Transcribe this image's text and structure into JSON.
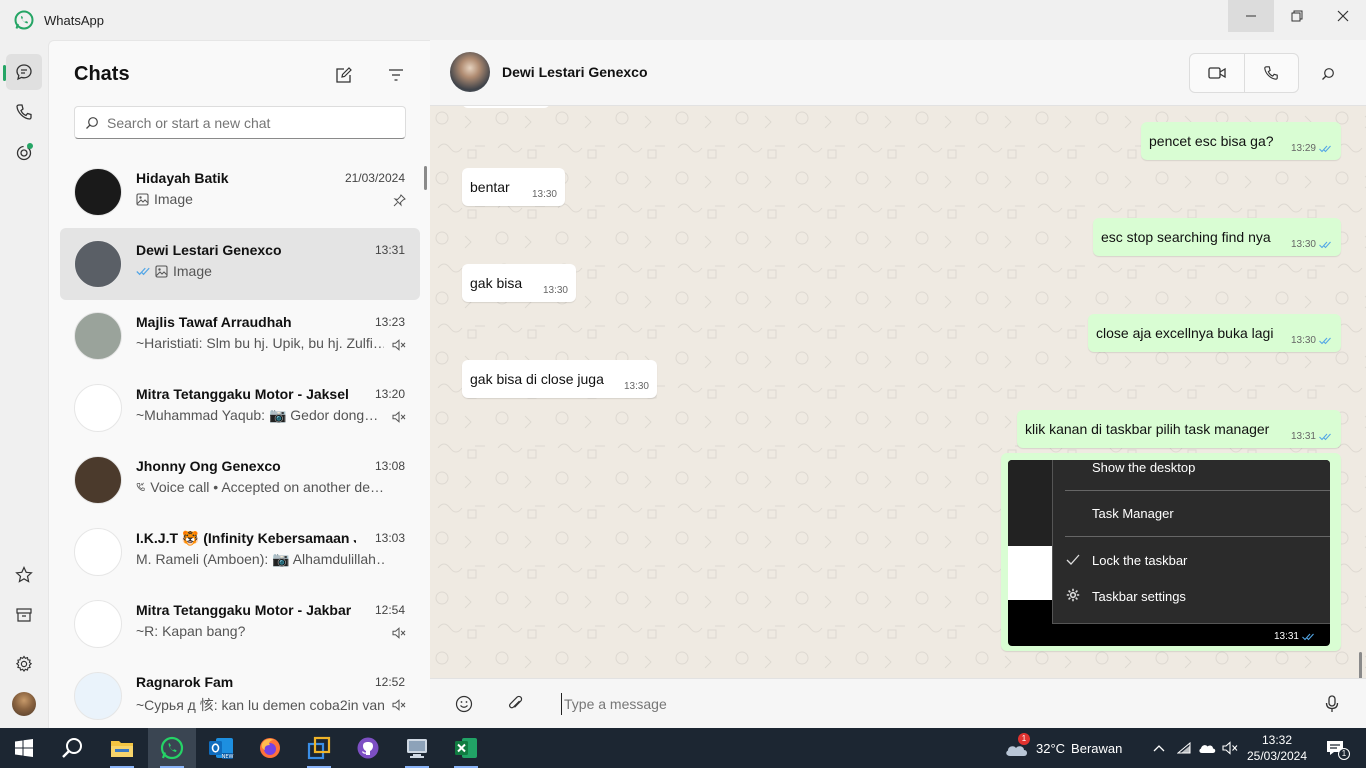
{
  "window": {
    "title": "WhatsApp"
  },
  "sidebar": {
    "title": "Chats",
    "search_placeholder": "Search or start a new chat",
    "chats": [
      {
        "name": "Hidayah Batik",
        "time": "21/03/2024",
        "preview": "Image",
        "preview_icon": "image-icon",
        "status_icon": "pin-icon",
        "avatar_color": "#1a1a1a"
      },
      {
        "name": "Dewi Lestari Genexco",
        "time": "13:31",
        "preview": "Image",
        "preview_icon": "image-icon",
        "ticks": true,
        "avatar_color": "#5a5f66",
        "selected": true
      },
      {
        "name": "Majlis Tawaf Arraudhah",
        "time": "13:23",
        "preview": "~Haristiati: Slm bu hj. Upik, bu hj. Zulfi…",
        "status_icon": "muted-icon",
        "avatar_color": "#9aa39b"
      },
      {
        "name": "Mitra Tetanggaku Motor - Jaksel",
        "time": "13:20",
        "preview": "~Muhammad Yaqub: 📷 Gedor dong…",
        "status_icon": "muted-icon",
        "avatar_color": "#ffffff"
      },
      {
        "name": "Jhonny Ong Genexco",
        "time": "13:08",
        "preview": "Voice call • Accepted on another de…",
        "preview_icon": "voice-call-icon",
        "avatar_color": "#4b3a2c"
      },
      {
        "name": "I.K.J.T 🐯 (Infinity Kebersamaan J…",
        "time": "13:03",
        "preview": "M. Rameli (Amboen): 📷 Alhamdulillah…",
        "avatar_color": "#ffffff"
      },
      {
        "name": "Mitra Tetanggaku Motor - Jakbar",
        "time": "12:54",
        "preview": "~R: Kapan bang?",
        "status_icon": "muted-icon",
        "avatar_color": "#ffffff"
      },
      {
        "name": "Ragnarok Fam",
        "time": "12:52",
        "preview": "~Сурья д 㤥: kan lu demen coba2in van",
        "status_icon": "muted-icon",
        "avatar_color": "#eaf3fb"
      }
    ]
  },
  "chat": {
    "contact_name": "Dewi Lestari Genexco",
    "messages": [
      {
        "dir": "out",
        "text": "pencet esc bisa ga?",
        "time": "13:29"
      },
      {
        "dir": "in",
        "text": "bentar",
        "time": "13:30"
      },
      {
        "dir": "out",
        "text": "esc stop searching find nya",
        "time": "13:30"
      },
      {
        "dir": "in",
        "text": "gak bisa",
        "time": "13:30"
      },
      {
        "dir": "out",
        "text": "close aja excellnya buka lagi",
        "time": "13:30"
      },
      {
        "dir": "in",
        "text": "gak bisa di close juga",
        "time": "13:30"
      },
      {
        "dir": "out",
        "text": "klik kanan di taskbar pilih task manager",
        "time": "13:31"
      }
    ],
    "image_message": {
      "time": "13:31",
      "menu_items": [
        "Show the desktop",
        "Task Manager",
        "Lock the taskbar",
        "Taskbar settings"
      ]
    },
    "composer_placeholder": "Type a message"
  },
  "taskbar": {
    "weather_temp": "32°C",
    "weather_desc": "Berawan",
    "weather_badge": "1",
    "clock_time": "13:32",
    "clock_date": "25/03/2024",
    "notification_count": "1",
    "apps": [
      "windows-start",
      "search",
      "file-explorer",
      "whatsapp",
      "outlook",
      "firefox",
      "virtualbox",
      "github-desktop",
      "remote-desktop",
      "excel"
    ]
  },
  "colors": {
    "accent": "#25a565",
    "outgoing_bubble": "#d9fdd3",
    "incoming_bubble": "#ffffff",
    "chat_bg": "#efeae2",
    "tick_blue": "#53a6e6",
    "taskbar_bg": "#1c2632"
  }
}
